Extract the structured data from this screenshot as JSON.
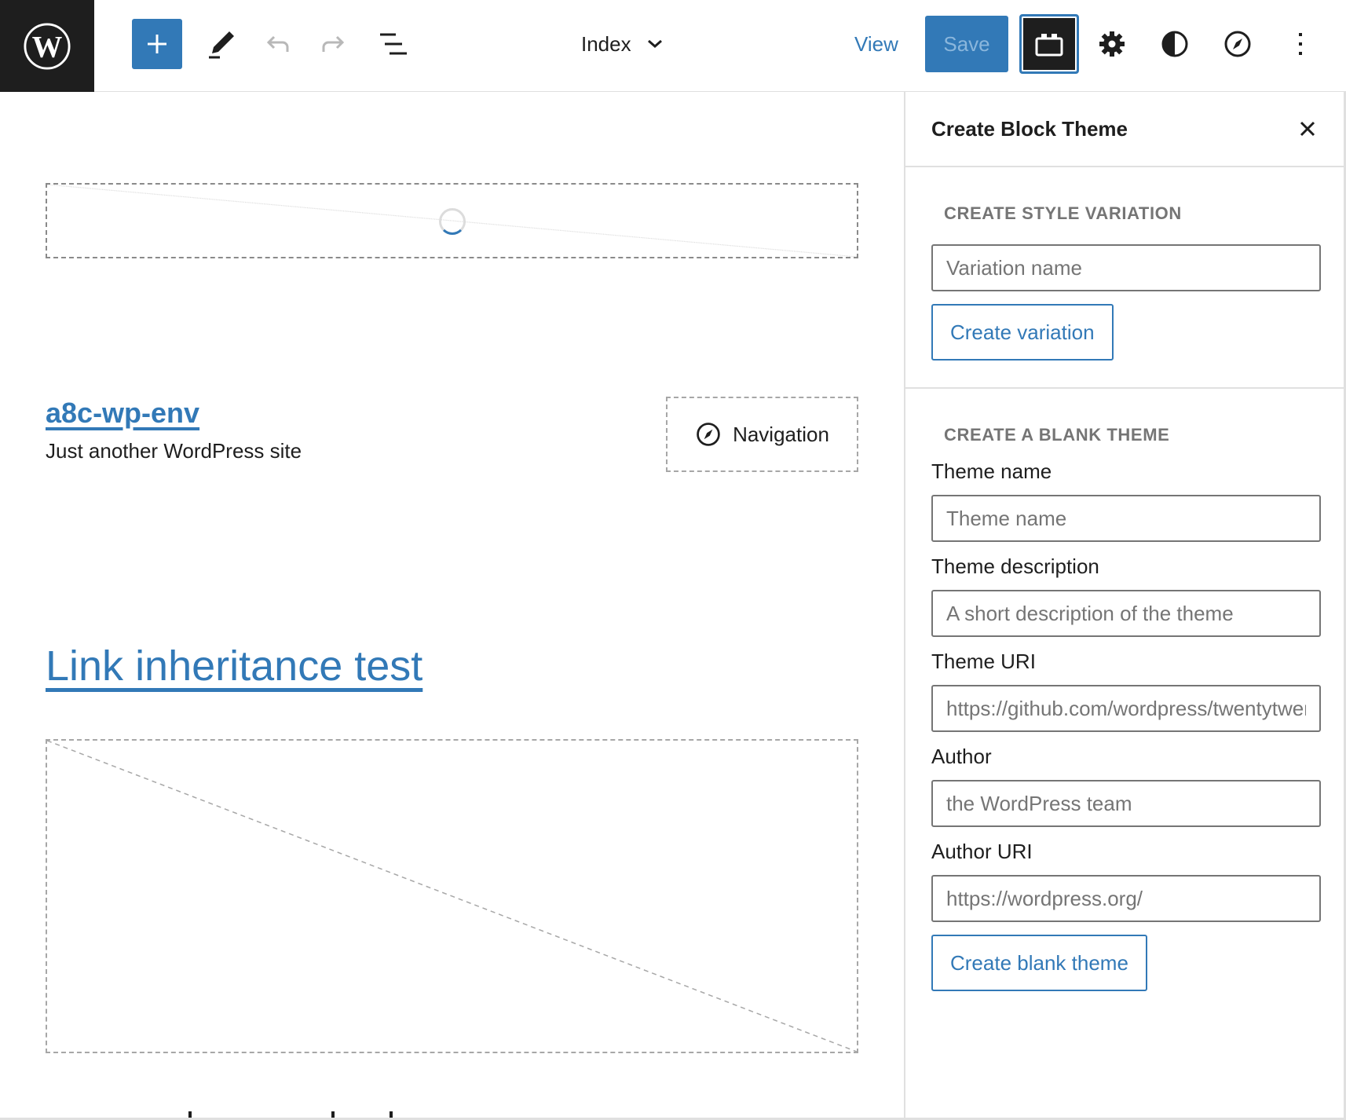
{
  "header": {
    "logo_icon": "wordpress-logo-icon",
    "add_block_icon": "plus-icon",
    "tools": [
      {
        "name": "edit-tool",
        "icon": "pencil-icon"
      },
      {
        "name": "undo",
        "icon": "undo-icon"
      },
      {
        "name": "redo",
        "icon": "redo-icon"
      },
      {
        "name": "list-view",
        "icon": "list-view-icon"
      }
    ],
    "document_title": "Index",
    "document_title_icon": "chevron-down-icon",
    "view_label": "View",
    "save_label": "Save",
    "right_icons": [
      "create-block-theme-icon",
      "gear-icon",
      "contrast-icon",
      "compass-icon",
      "more-vertical-icon"
    ]
  },
  "canvas": {
    "site_title": "a8c-wp-env",
    "site_tagline": "Just another WordPress site",
    "navigation_label": "Navigation",
    "post_title": "Link inheritance test"
  },
  "sidebar": {
    "title": "Create Block Theme",
    "style_variation": {
      "heading": "CREATE STYLE VARIATION",
      "input_placeholder": "Variation name",
      "button_label": "Create variation"
    },
    "blank_theme": {
      "heading": "CREATE A BLANK THEME",
      "fields": [
        {
          "label": "Theme name",
          "placeholder": "Theme name"
        },
        {
          "label": "Theme description",
          "placeholder": "A short description of the theme"
        },
        {
          "label": "Theme URI",
          "placeholder": "https://github.com/wordpress/twentytwentytwo"
        },
        {
          "label": "Author",
          "placeholder": "the WordPress team"
        },
        {
          "label": "Author URI",
          "placeholder": "https://wordpress.org/"
        }
      ],
      "button_label": "Create blank theme"
    }
  },
  "colors": {
    "accent": "#3279b7",
    "dark": "#1e1e1e",
    "muted": "#757575",
    "border": "#e0e0e0"
  }
}
